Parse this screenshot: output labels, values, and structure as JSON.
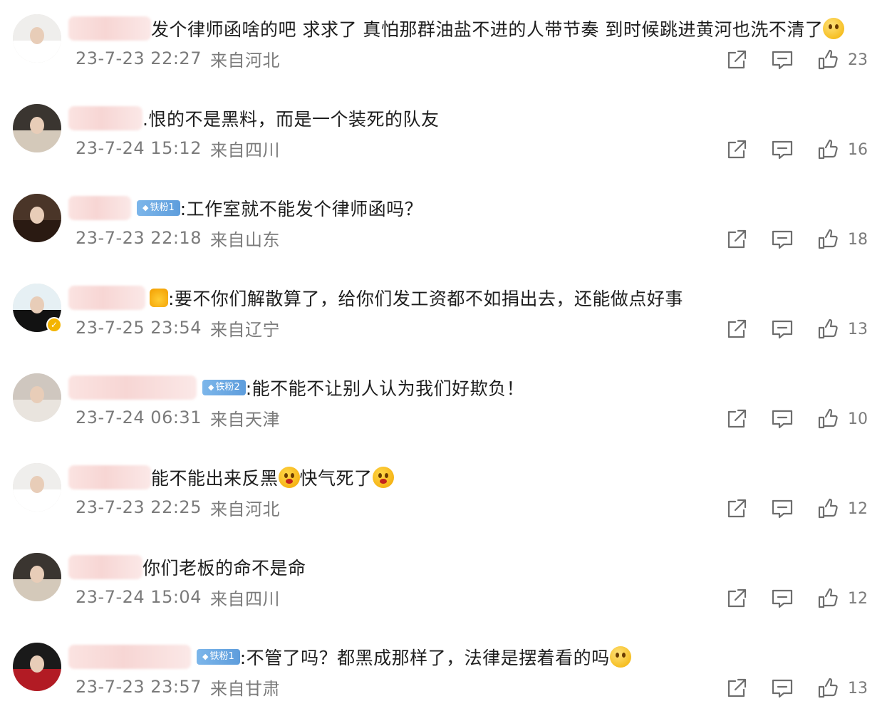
{
  "comments": [
    {
      "text": "发个律师函啥的吧 求求了 真怕那群油盐不进的人带节奏 到时候跳进黄河也洗不清了",
      "trailing_emoji": "crying-face",
      "date": "23-7-23 22:27",
      "location": "来自河北",
      "likes": "23",
      "avatar_colors": [
        "#efeeec",
        "#ffffff"
      ],
      "name_blur_width": 116
    },
    {
      "text": ".恨的不是黑料，而是一个装死的队友",
      "date": "23-7-24 15:12",
      "location": "来自四川",
      "likes": "16",
      "avatar_colors": [
        "#3a3530",
        "#d4c9ba"
      ],
      "name_blur_width": 104
    },
    {
      "badge": "铁粉1",
      "text": ":工作室就不能发个律师函吗？",
      "date": "23-7-23 22:18",
      "location": "来自山东",
      "likes": "18",
      "avatar_colors": [
        "#4a3528",
        "#2a1a12"
      ],
      "name_blur_width": 88
    },
    {
      "crown": true,
      "text": ":要不你们解散算了，给你们发工资都不如捐出去，还能做点好事",
      "date": "23-7-25 23:54",
      "location": "来自辽宁",
      "likes": "13",
      "avatar_colors": [
        "#e6f0f4",
        "#121212"
      ],
      "verified": true,
      "name_blur_width": 108
    },
    {
      "badge": "铁粉2",
      "text": ":能不能不让别人认为我们好欺负！",
      "date": "23-7-24 06:31",
      "location": "来自天津",
      "likes": "10",
      "avatar_colors": [
        "#cfc7bf",
        "#e9e4de"
      ],
      "name_blur_width": 180
    },
    {
      "text": "能不能出来反黑",
      "mid_emoji": "surprised-face",
      "text2": "快气死了",
      "trailing_emoji": "surprised-face",
      "date": "23-7-23 22:25",
      "location": "来自河北",
      "likes": "12",
      "avatar_colors": [
        "#efeeec",
        "#ffffff"
      ],
      "name_blur_width": 116
    },
    {
      "text": "你们老板的命不是命",
      "date": "23-7-24 15:04",
      "location": "来自四川",
      "likes": "12",
      "avatar_colors": [
        "#3a3530",
        "#d4c9ba"
      ],
      "name_blur_width": 104
    },
    {
      "badge": "铁粉1",
      "text": ":不管了吗？都黑成那样了，法律是摆着看的吗",
      "trailing_emoji": "crying-face",
      "date": "23-7-23 23:57",
      "location": "来自甘肃",
      "likes": "13",
      "avatar_colors": [
        "#1a1a1a",
        "#b21b24"
      ],
      "name_blur_width": 172
    }
  ]
}
